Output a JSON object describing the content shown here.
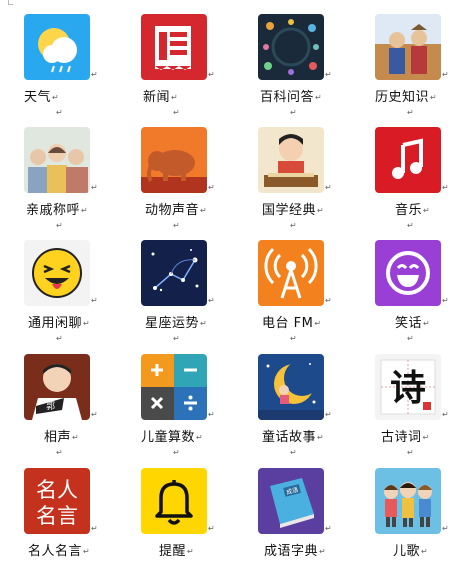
{
  "paragraph_mark": "↵",
  "apps": [
    {
      "id": "weather",
      "label": "天气",
      "icon": "weather-icon",
      "bg": "#29a8ef"
    },
    {
      "id": "news",
      "label": "新闻",
      "icon": "news-icon",
      "bg": "#d4272e"
    },
    {
      "id": "encyclopedia",
      "label": "百科问答",
      "icon": "space-encyclopedia-icon",
      "bg": "#1b2a3a"
    },
    {
      "id": "history",
      "label": "历史知识",
      "icon": "history-painting-icon",
      "bg": "#c08a4a"
    },
    {
      "id": "relatives",
      "label": "亲戚称呼",
      "icon": "family-icon",
      "bg": "#dfe7df"
    },
    {
      "id": "animals",
      "label": "动物声音",
      "icon": "elephant-icon",
      "bg": "#f07a2a"
    },
    {
      "id": "classics",
      "label": "国学经典",
      "icon": "classics-girl-icon",
      "bg": "#f2e6cc"
    },
    {
      "id": "music",
      "label": "音乐",
      "icon": "music-note-icon",
      "bg": "#d91b25"
    },
    {
      "id": "chat",
      "label": "通用闲聊",
      "icon": "laughing-face-icon",
      "bg": "#ffffff"
    },
    {
      "id": "horoscope",
      "label": "星座运势",
      "icon": "constellation-icon",
      "bg": "#12204a"
    },
    {
      "id": "radio",
      "label": "电台 FM",
      "icon": "radio-tower-icon",
      "bg": "#f3811e"
    },
    {
      "id": "jokes",
      "label": "笑话",
      "icon": "smile-face-icon",
      "bg": "#9a3fd6"
    },
    {
      "id": "crosstalk",
      "label": "相声",
      "icon": "crosstalk-performer-icon",
      "bg": "#7a2d1a"
    },
    {
      "id": "math",
      "label": "儿童算数",
      "icon": "calculator-icon",
      "bg": "#3aa0b0"
    },
    {
      "id": "fairytale",
      "label": "童话故事",
      "icon": "moon-girl-icon",
      "bg": "#1d4a8a"
    },
    {
      "id": "poetry",
      "label": "古诗词",
      "icon": "poem-character-icon",
      "bg": "#f4f4f4"
    },
    {
      "id": "quotes",
      "label": "名人名言",
      "icon": "famous-quotes-icon",
      "bg": "#c4321e"
    },
    {
      "id": "reminder",
      "label": "提醒",
      "icon": "bell-icon",
      "bg": "#ffd600"
    },
    {
      "id": "idioms",
      "label": "成语字典",
      "icon": "idiom-book-icon",
      "bg": "#5a3ea0"
    },
    {
      "id": "songs",
      "label": "儿歌",
      "icon": "children-icon",
      "bg": "#6cc0e4"
    }
  ],
  "text_in_icons": {
    "quotes_line1": "名人",
    "quotes_line2": "名言",
    "poetry_char": "诗",
    "crosstalk_badge": "郭",
    "idiom_book_title": "成语"
  }
}
